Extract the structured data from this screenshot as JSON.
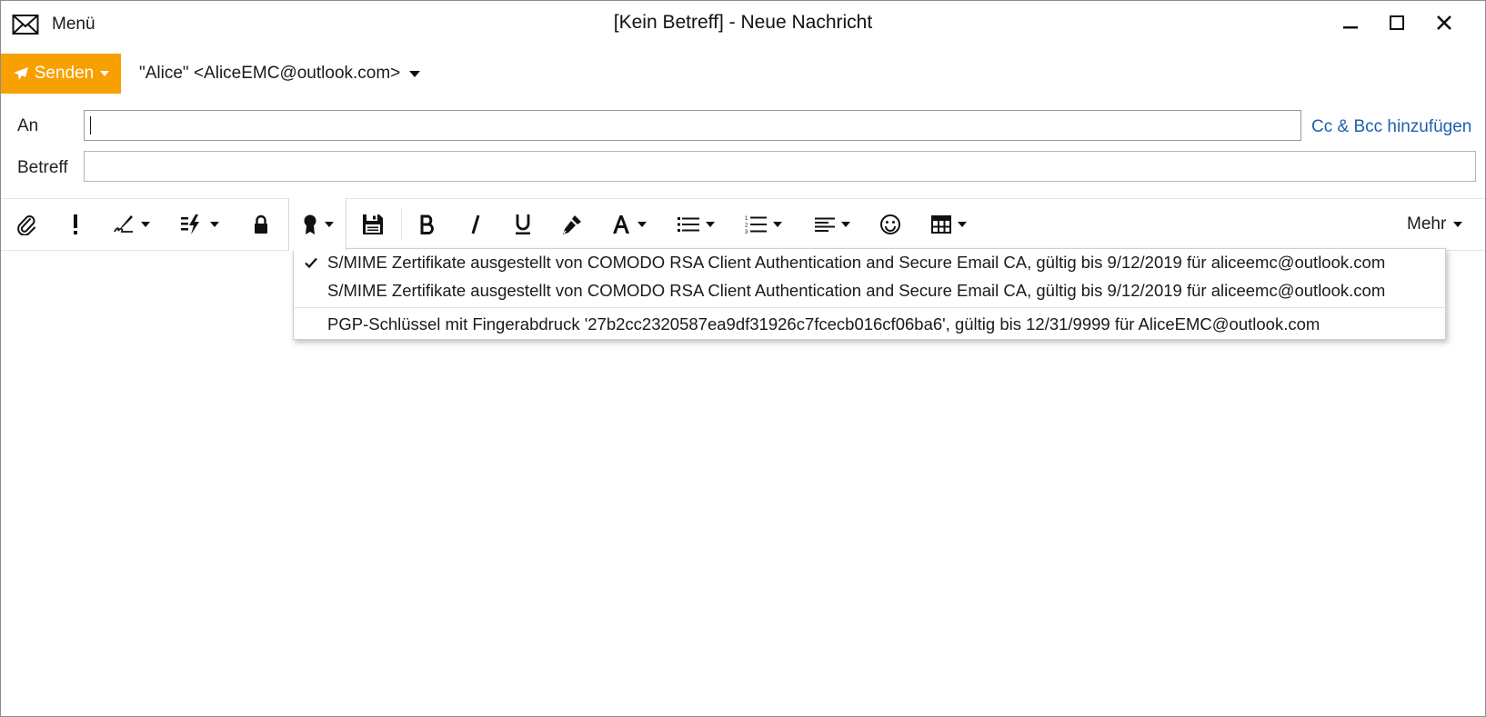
{
  "window": {
    "menu_label": "Menü",
    "title": "[Kein Betreff] - Neue Nachricht"
  },
  "compose": {
    "send_label": "Senden",
    "from": "\"Alice\" <AliceEMC@outlook.com>",
    "to_label": "An",
    "to_value": "",
    "cc_bcc_link": "Cc & Bcc hinzufügen",
    "subject_label": "Betreff",
    "subject_value": ""
  },
  "toolbar": {
    "more_label": "Mehr",
    "icons": [
      "paperclip-icon",
      "importance-icon",
      "signature-icon",
      "quick-text-icon",
      "lock-icon",
      "certificate-icon",
      "save-icon",
      "bold-icon",
      "italic-icon",
      "underline-icon",
      "format-painter-icon",
      "font-icon",
      "bullet-list-icon",
      "numbered-list-icon",
      "align-icon",
      "emoji-icon",
      "table-icon"
    ]
  },
  "signing_menu": {
    "items": [
      {
        "label": "S/MIME Zertifikate ausgestellt von COMODO RSA Client Authentication and Secure Email CA, gültig bis 9/12/2019 für aliceemc@outlook.com",
        "checked": true
      },
      {
        "label": "S/MIME Zertifikate ausgestellt von COMODO RSA Client Authentication and Secure Email CA, gültig bis 9/12/2019 für aliceemc@outlook.com",
        "checked": false
      },
      {
        "label": "PGP-Schlüssel mit Fingerabdruck '27b2cc2320587ea9df31926c7fcecb016cf06ba6', gültig bis 12/31/9999 für AliceEMC@outlook.com",
        "checked": false
      }
    ]
  },
  "colors": {
    "send_button": "#f7a000",
    "link": "#1f5fae"
  }
}
